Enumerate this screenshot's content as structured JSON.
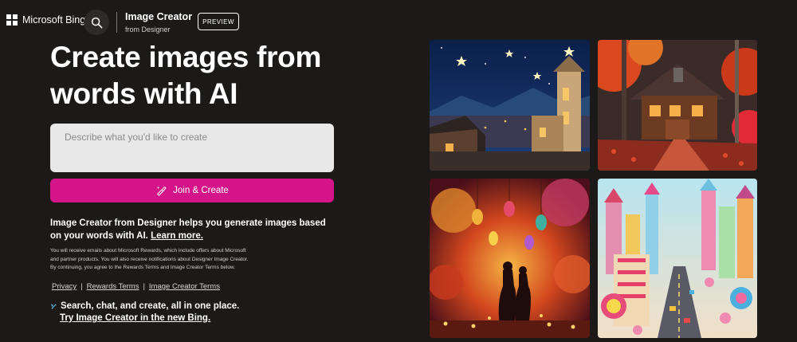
{
  "header": {
    "brand": "Microsoft Bing",
    "product_title": "Image Creator",
    "product_subtitle": "from Designer",
    "preview_badge": "PREVIEW",
    "search_icon": "search-icon",
    "brand_icon": "microsoft-logo-icon"
  },
  "hero": {
    "headline_line1": "Create images from",
    "headline_line2": "words with AI"
  },
  "prompt": {
    "placeholder": "Describe what you'd like to create",
    "value": ""
  },
  "join_button": {
    "label": "Join & Create",
    "icon": "brush-sparkle-icon"
  },
  "description": {
    "text": "Image Creator from Designer helps you generate images based on your words with AI.",
    "link": "Learn more."
  },
  "fine_print": {
    "line1": "You will receive emails about Microsoft Rewards, which include offers about Microsoft",
    "line2": "and partner products. You will also receive notifications about Designer Image Creator.",
    "line3": "By continuing, you agree to the Rewards Terms and Image Creator Terms below."
  },
  "legal_links": {
    "privacy": "Privacy",
    "separator": "|",
    "rewards_terms": "Rewards Terms",
    "image_creator_terms": "Image Creator Terms"
  },
  "promo": {
    "text": "Search, chat, and create, all in one place.",
    "link": "Try Image Creator in the new Bing."
  },
  "colors": {
    "background": "#1b1a19",
    "accent": "#d5148a",
    "input_bg": "#e8e8e8"
  }
}
